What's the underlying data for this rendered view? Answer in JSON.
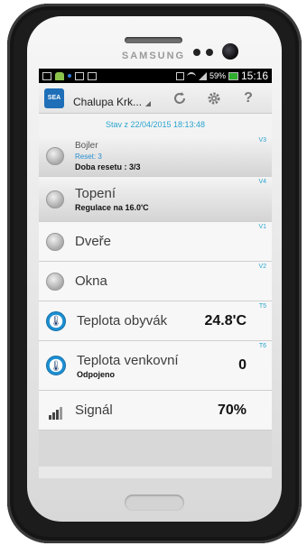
{
  "device": {
    "brand": "SAMSUNG"
  },
  "statusbar": {
    "battery": "59%",
    "time": "15:16"
  },
  "actionbar": {
    "logo_text": "SEA",
    "selected_location": "Chalupa Krk...",
    "icons": [
      "refresh-icon",
      "settings-icon",
      "help-icon"
    ],
    "help_label": "?"
  },
  "status_line": "Stav z 22/04/2015 18:13:48",
  "items": [
    {
      "code": "V3",
      "name": "Bojler",
      "sub1": "Reset: 3",
      "sub2": "Doba resetu : 3/3",
      "type": "led"
    },
    {
      "code": "V4",
      "name": "Topení",
      "sub2": "Regulace na 16.0'C",
      "type": "led"
    },
    {
      "code": "V1",
      "name": "Dveře",
      "type": "led"
    },
    {
      "code": "V2",
      "name": "Okna",
      "type": "led"
    },
    {
      "code": "T5",
      "name": "Teplota obyvák",
      "value": "24.8'C",
      "type": "thermo"
    },
    {
      "code": "T6",
      "name": "Teplota venkovní",
      "value": "0",
      "sub2": "Odpojeno",
      "type": "thermo"
    },
    {
      "name": "Signál",
      "value": "70%",
      "type": "signal"
    }
  ],
  "colors": {
    "accent": "#29a4cf",
    "logo": "#1f6fb8"
  }
}
